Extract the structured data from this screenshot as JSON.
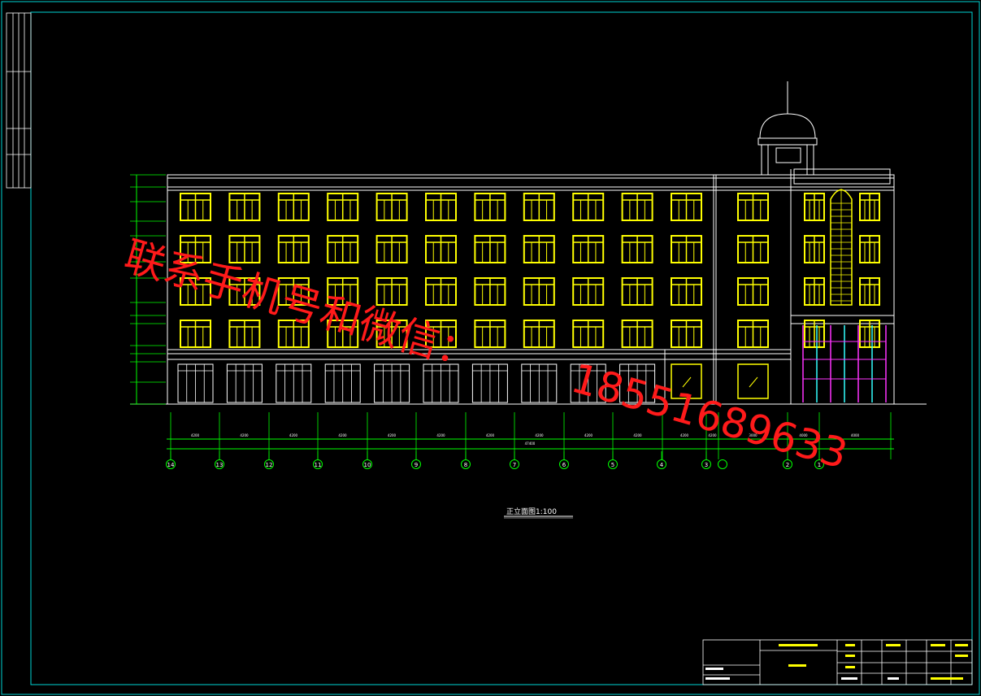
{
  "drawing": {
    "caption": "正立面图1:100",
    "total_dimension": "47400",
    "dimensions": [
      "4200",
      "4200",
      "4200",
      "4200",
      "4200",
      "4200",
      "4200",
      "4200",
      "4200",
      "4200",
      "4200",
      "4200",
      "3000",
      "4000",
      "4000"
    ],
    "axes": [
      "14",
      "13",
      "12",
      "11",
      "10",
      "9",
      "8",
      "7",
      "6",
      "5",
      "4",
      "3",
      "2",
      "1"
    ]
  },
  "watermark": {
    "line1": "联系手机号和微信：",
    "line2": "18551689633"
  },
  "colors": {
    "frame": "#00d4d4",
    "structure": "#ffffff",
    "windows": "#ffff00",
    "dimension": "#00ff00",
    "watermark": "#ff1a1a",
    "curtain_wall_a": "#ff33ff",
    "curtain_wall_b": "#33ffff"
  }
}
